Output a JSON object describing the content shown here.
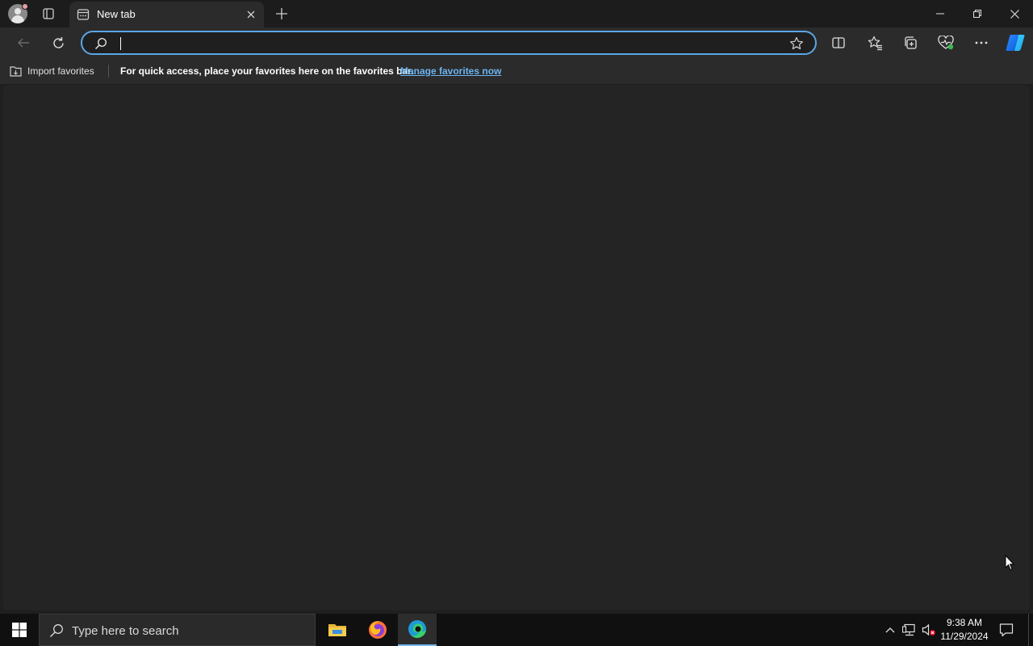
{
  "browser": {
    "tab": {
      "title": "New tab"
    },
    "address_bar": {
      "value": "",
      "placeholder": ""
    },
    "favorites_bar": {
      "import_label": "Import favorites",
      "message": "For quick access, place your favorites here on the favorites bar.",
      "link": "Manage favorites now"
    },
    "window_controls": [
      "minimize-icon",
      "restore-icon",
      "close-icon"
    ],
    "toolbar_icons": [
      "split-screen-icon",
      "favorites-icon",
      "collections-icon",
      "browser-essentials-icon",
      "more-icon",
      "copilot-icon"
    ]
  },
  "taskbar": {
    "search_placeholder": "Type here to search",
    "pinned_apps": [
      "file-explorer-icon",
      "firefox-icon",
      "edge-icon"
    ],
    "clock": {
      "time": "9:38 AM",
      "date": "11/29/2024"
    }
  },
  "colors": {
    "accent": "#5aa7e6",
    "link": "#6cb4f0",
    "tab_active": "#2b2b2b",
    "content_bg": "#242424"
  }
}
